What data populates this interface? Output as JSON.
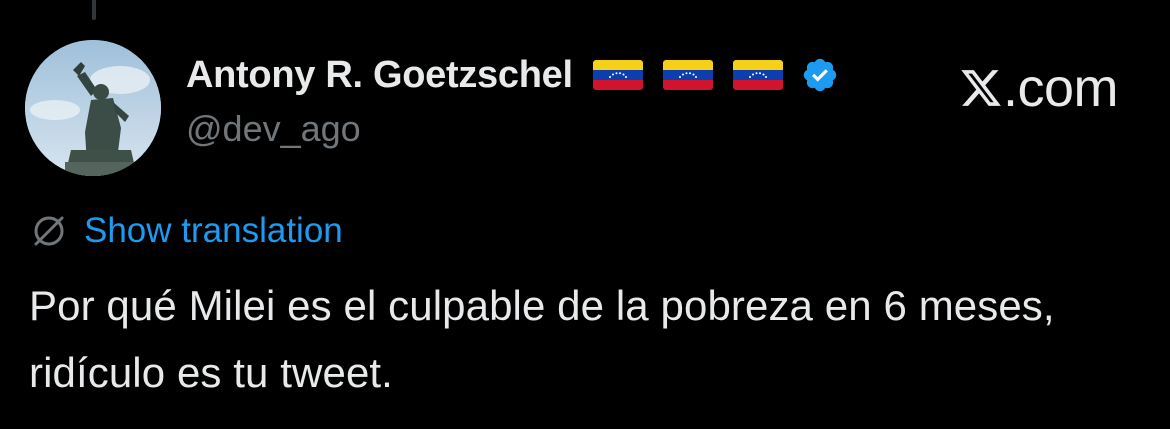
{
  "tweet": {
    "author": {
      "display_name": "Antony R. Goetzschel",
      "handle": "@dev_ago",
      "flags": [
        "venezuela-flag",
        "venezuela-flag",
        "venezuela-flag"
      ],
      "verified": true,
      "avatar": "statue-photo"
    },
    "source": {
      "logo": "x-logo",
      "domain": ".com"
    },
    "translation": {
      "icon": "no-translate-globe-icon",
      "label": "Show translation"
    },
    "text": "Por qué Milei es el culpable de la pobreza en 6 meses, ridículo es tu tweet."
  },
  "colors": {
    "background": "#000000",
    "primary_text": "#e7e9ea",
    "secondary_text": "#71767b",
    "link": "#1d9bf0",
    "verified_badge": "#1d9bf0"
  }
}
